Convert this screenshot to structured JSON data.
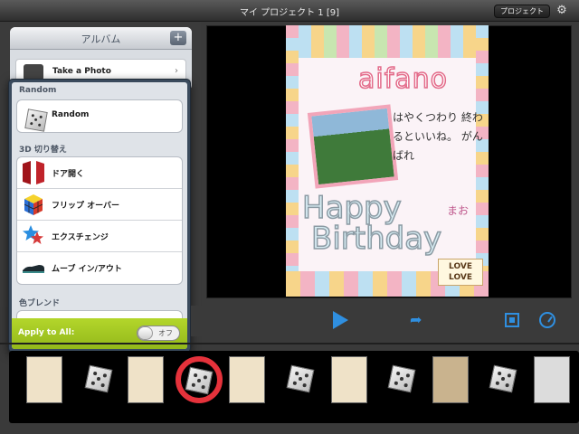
{
  "window": {
    "title": "マイ プロジェクト 1  [9]",
    "projects_button": "プロジェクト",
    "settings_icon": "gear-icon"
  },
  "album": {
    "title": "アルバム",
    "add_icon": "+",
    "rows": [
      {
        "label": "Take a Photo",
        "icon": "camera-icon"
      }
    ]
  },
  "transitions": {
    "sections": [
      {
        "header": "Random",
        "items": [
          {
            "label": "Random",
            "icon": "dice-icon"
          }
        ]
      },
      {
        "header": "3D 切り替え",
        "items": [
          {
            "label": "ドア開く",
            "icon": "door-icon"
          },
          {
            "label": "フリップ オーバー",
            "icon": "flip-cube-icon"
          },
          {
            "label": "エクスチェンジ",
            "icon": "exchange-stars-icon"
          },
          {
            "label": "ムーブ イン/アウト",
            "icon": "move-shoe-icon"
          }
        ]
      },
      {
        "header": "色ブレンド",
        "items": []
      }
    ],
    "apply_all_label": "Apply to All:",
    "apply_all_toggle": "オフ"
  },
  "preview": {
    "name_text": "aifano",
    "message_text": "はやくつわり 終わるといいね。 がんばれ",
    "happy_text": "Happy",
    "birthday_text": "Birthday",
    "love_text": "LOVE LOVE",
    "mao_text": "まお"
  },
  "playback": {
    "play_icon": "play-icon",
    "share_icon": "share-icon",
    "fit_icon": "fit-screen-icon",
    "speed_icon": "speed-dial-icon"
  },
  "timeline": {
    "thumbs_bg": [
      "#efe2c8",
      "#efe2c8",
      "#efe2c8",
      "#efe2c8",
      "#c9b38e",
      "#dcdcdc",
      "#ececec"
    ],
    "highlight_color": "#e5323b"
  }
}
